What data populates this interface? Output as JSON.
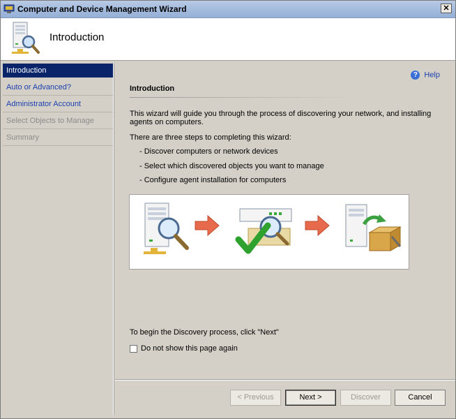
{
  "window": {
    "title": "Computer and Device Management Wizard"
  },
  "header": {
    "title": "Introduction"
  },
  "sidebar": {
    "items": [
      {
        "label": "Introduction",
        "state": "active"
      },
      {
        "label": "Auto or Advanced?",
        "state": "link"
      },
      {
        "label": "Administrator Account",
        "state": "link"
      },
      {
        "label": "Select Objects to Manage",
        "state": "disabled"
      },
      {
        "label": "Summary",
        "state": "disabled"
      }
    ]
  },
  "content": {
    "help_label": "Help",
    "section_title": "Introduction",
    "intro_text": "This wizard will guide you through the process of discovering your network, and installing agents on computers.",
    "steps_intro": "There are three steps to completing this wizard:",
    "steps": [
      "- Discover computers or network devices",
      "- Select which discovered objects you want to manage",
      "- Configure agent installation for computers"
    ],
    "begin_text": "To begin the Discovery process, click \"Next\"",
    "checkbox_label": "Do not show this page again",
    "checkbox_checked": false
  },
  "footer": {
    "previous_label": "< Previous",
    "next_label": "Next >",
    "discover_label": "Discover",
    "cancel_label": "Cancel"
  },
  "colors": {
    "accent": "#0a246a",
    "link": "#1b3fae",
    "disabled": "#8c8c8c",
    "arrow": "#e05a3c",
    "check": "#2fa12f"
  },
  "icons": {
    "title": "wizard-computer-icon",
    "header": "server-magnifier-icon",
    "help": "help-question-icon",
    "diagram": [
      "server-search-icon",
      "arrow-right-icon",
      "network-device-check-icon",
      "arrow-right-icon",
      "computer-agent-install-icon"
    ]
  }
}
